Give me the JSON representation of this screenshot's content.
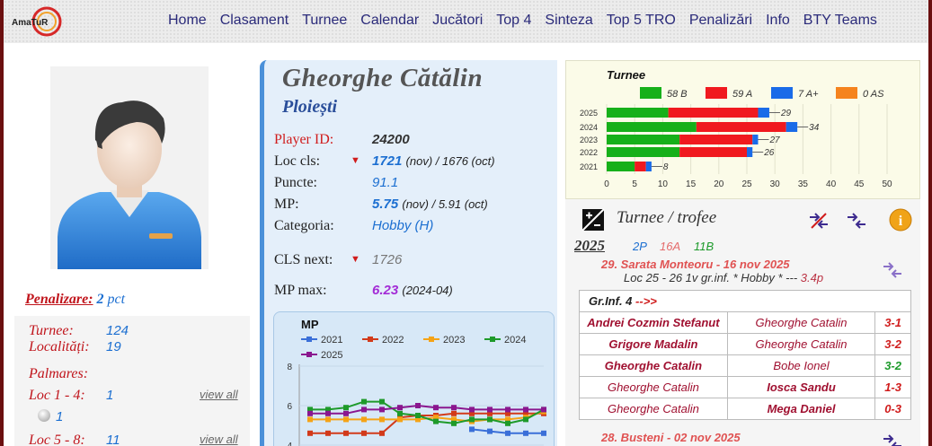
{
  "header": {
    "logo_text": "AmaTuR",
    "nav": [
      "Home",
      "Clasament",
      "Turnee",
      "Calendar",
      "Jucători",
      "Top 4",
      "Sinteza",
      "Top 5 TRO",
      "Penalizări",
      "Info",
      "BTY Teams"
    ]
  },
  "left": {
    "penal_label": "Penalizare:",
    "penal_value": "2",
    "penal_unit": "pct",
    "turnee_label": "Turnee:",
    "turnee_value": "124",
    "localitati_label": "Localități:",
    "localitati_value": "19",
    "palmares_label": "Palmares:",
    "loc14_label": "Loc 1 - 4:",
    "loc14_value": "1",
    "loc14_sub": "1",
    "loc58_label": "Loc 5 - 8:",
    "loc58_value": "11",
    "view_all": "view all"
  },
  "player": {
    "name": "Gheorghe Cătălin",
    "city": "Ploiești",
    "fields": {
      "id_label": "Player ID:",
      "id_value": "24200",
      "loc_label": "Loc cls:",
      "loc_value": "1721",
      "loc_note": "(nov) / 1676 (oct)",
      "puncte_label": "Puncte:",
      "puncte_value": "91.1",
      "mp_label": "MP:",
      "mp_value": "5.75",
      "mp_note": "(nov) / 5.91 (oct)",
      "cat_label": "Categoria:",
      "cat_value": "Hobby (H)",
      "clsnext_label": "CLS next:",
      "clsnext_value": "1726",
      "mpmax_label": "MP max:",
      "mpmax_value": "6.23",
      "mpmax_note": "(2024-04)"
    }
  },
  "mp_chart": {
    "title": "MP",
    "colors": {
      "2021": "#3a6fd8",
      "2022": "#d23a1a",
      "2023": "#f5a316",
      "2024": "#1e9a2a",
      "2025": "#8a178f"
    },
    "chart_data": {
      "type": "line",
      "title": "MP",
      "ylim": [
        4,
        8
      ],
      "yticks": [
        "8",
        "6",
        "4"
      ],
      "series": [
        {
          "name": "2021",
          "values": [
            null,
            null,
            null,
            null,
            null,
            null,
            null,
            null,
            null,
            4.8,
            4.7,
            4.6,
            4.6,
            4.6
          ]
        },
        {
          "name": "2022",
          "values": [
            4.6,
            4.6,
            4.6,
            4.6,
            4.6,
            5.4,
            5.5,
            5.5,
            5.6,
            5.6,
            5.6,
            5.6,
            5.6,
            5.6
          ]
        },
        {
          "name": "2023",
          "values": [
            5.3,
            5.3,
            5.3,
            5.3,
            5.3,
            5.3,
            5.3,
            5.4,
            5.3,
            5.2,
            5.3,
            5.3,
            5.4,
            5.7
          ]
        },
        {
          "name": "2024",
          "values": [
            5.8,
            5.8,
            5.9,
            6.2,
            6.2,
            5.6,
            5.5,
            5.2,
            5.1,
            5.3,
            5.3,
            5.1,
            5.3,
            5.8
          ]
        },
        {
          "name": "2025",
          "values": [
            5.6,
            5.6,
            5.6,
            5.8,
            5.8,
            5.9,
            6.0,
            5.9,
            5.9,
            5.8,
            5.8,
            5.8,
            5.8,
            5.8
          ]
        }
      ]
    }
  },
  "turnee_chart": {
    "title": "Turnee",
    "colors": {
      "B": "#16b01a",
      "A": "#f0191f",
      "A+": "#1a6be8",
      "AS": "#f5831e"
    },
    "chart_data": {
      "type": "bar",
      "orientation": "horizontal",
      "stacked": true,
      "title": "Turnee",
      "categories": [
        "2025",
        "2024",
        "2023",
        "2022",
        "2021"
      ],
      "series": [
        {
          "name": "58 B",
          "values": [
            11,
            16,
            13,
            13,
            5
          ]
        },
        {
          "name": "59 A",
          "values": [
            16,
            16,
            13,
            12,
            2
          ]
        },
        {
          "name": "7 A+",
          "values": [
            2,
            2,
            1,
            1,
            1
          ]
        },
        {
          "name": "0 AS",
          "values": [
            0,
            0,
            0,
            0,
            0
          ]
        }
      ],
      "totals": [
        "29",
        "34",
        "27",
        "26",
        "8"
      ],
      "xticks": [
        "0",
        "5",
        "10",
        "15",
        "20",
        "25",
        "30",
        "35",
        "40",
        "45",
        "50"
      ],
      "xlim": [
        0,
        50
      ]
    }
  },
  "trofee": {
    "title": "Turnee / trofee",
    "year": "2025",
    "count_p": "2P",
    "count_a": "16A",
    "count_b": "11B",
    "event1": "29. Sarata Monteoru - 16 nov 2025",
    "event1_sub": "Loc 25 - 26 1v gr.inf. * Hobby * --- ",
    "event1_pts": "3.4p",
    "group_label": "Gr.Inf. 4",
    "group_arrow": "-->>",
    "games": [
      {
        "p1": "Andrei Cozmin Stefanut",
        "p2": "Gheorghe Catalin",
        "score": "3-1",
        "winner": 1
      },
      {
        "p1": "Grigore Madalin",
        "p2": "Gheorghe Catalin",
        "score": "3-2",
        "winner": 1
      },
      {
        "p1": "Gheorghe Catalin",
        "p2": "Bobe Ionel",
        "score": "3-2",
        "winner": 1
      },
      {
        "p1": "Gheorghe Catalin",
        "p2": "Iosca Sandu",
        "score": "1-3",
        "winner": 2
      },
      {
        "p1": "Gheorghe Catalin",
        "p2": "Mega Daniel",
        "score": "0-3",
        "winner": 2
      }
    ],
    "event2": "28. Busteni - 02 nov 2025"
  }
}
